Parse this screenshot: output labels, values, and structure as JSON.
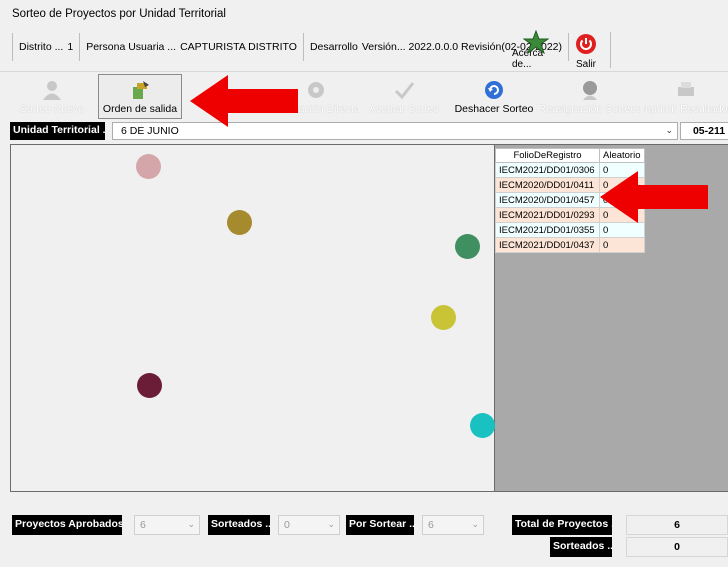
{
  "window": {
    "title": "Sorteo de Proyectos por Unidad Territorial"
  },
  "infobar": {
    "distrito": "Distrito ...",
    "distrito_num": "1",
    "usuaria": "Persona Usuaria ...",
    "rol": "CAPTURISTA DISTRITO",
    "desarrollo": "Desarrollo",
    "version": "Versión... 2022.0.0.0 Revisión(02-02-2022)"
  },
  "top_buttons": {
    "about": "Acerca de...",
    "exit": "Salir"
  },
  "toolbar": [
    {
      "label": "Sorteo Nuevo",
      "icon": "people-icon",
      "state": "disabled"
    },
    {
      "label": "Orden de salida",
      "icon": "sort-icon",
      "state": "active"
    },
    {
      "label": "",
      "icon": "globe-icon",
      "state": "disabled"
    },
    {
      "label": "Asignación Directa",
      "icon": "gear-icon",
      "state": "disabled"
    },
    {
      "label": "Aceptar Sorteo",
      "icon": "check-icon",
      "state": "disabled"
    },
    {
      "label": "Deshacer Sorteo",
      "icon": "undo-icon",
      "state": "enabled"
    },
    {
      "label": "Reasignación Sorteos",
      "icon": "people-icon",
      "state": "disabled"
    },
    {
      "label": "Imprimir Resultados",
      "icon": "printer-icon",
      "state": "disabled"
    }
  ],
  "unit": {
    "label": "Unidad Territorial ...",
    "selected": "6 DE JUNIO",
    "code": "05-211"
  },
  "grid": {
    "headers": [
      "FolioDeRegistro",
      "Aleatorio"
    ],
    "rows": [
      [
        "IECM2021/DD01/0306",
        "0"
      ],
      [
        "IECM2020/DD01/0411",
        "0"
      ],
      [
        "IECM2020/DD01/0457",
        "0"
      ],
      [
        "IECM2021/DD01/0293",
        "0"
      ],
      [
        "IECM2021/DD01/0355",
        "0"
      ],
      [
        "IECM2021/DD01/0437",
        "0"
      ]
    ]
  },
  "balls": [
    {
      "color": "#d4a6a9"
    },
    {
      "color": "#a68a2e"
    },
    {
      "color": "#3f8f60"
    },
    {
      "color": "#c9c336"
    },
    {
      "color": "#6b1d37"
    },
    {
      "color": "#19c1c1"
    }
  ],
  "footer": {
    "aprobados_label": "Proyectos Aprobados ...",
    "aprobados_value": "6",
    "sorteados_label": "Sorteados ...",
    "sorteados_value": "0",
    "por_sortear_label": "Por Sortear ...",
    "por_sortear_value": "6",
    "total_label": "Total de Proyectos ...",
    "total_value": "6",
    "sorteados2_label": "Sorteados ...",
    "sorteados2_value": "0"
  },
  "colors": {
    "arrow": "#ee0000",
    "label_bg": "#000000",
    "grid_bg": "#a9a9a9"
  }
}
